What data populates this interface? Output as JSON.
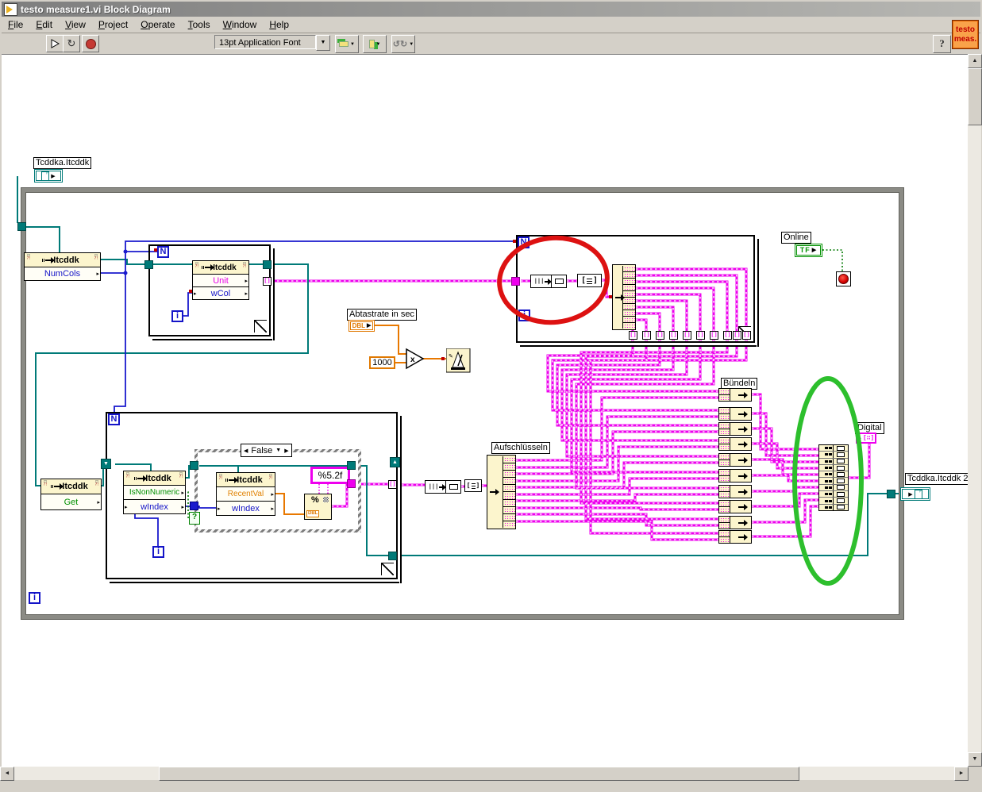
{
  "window": {
    "title": "testo measure1.vi Block Diagram",
    "close": "×"
  },
  "menu": {
    "items": [
      "File",
      "Edit",
      "View",
      "Project",
      "Operate",
      "Tools",
      "Window",
      "Help"
    ]
  },
  "toolbar": {
    "font": "13pt Application Font",
    "help": "?"
  },
  "vi_icon": {
    "line1": "testo",
    "line2": "meas."
  },
  "diagram": {
    "source_label": "Tcddka.Itcddk",
    "sink_label": "Tcddka.Itcddk 2",
    "loops": {
      "count": "N",
      "iter": "i"
    },
    "numcols": {
      "title": "Itcddk",
      "row0": "NumCols"
    },
    "unit": {
      "title": "Itcddk",
      "row0": "Unit",
      "row1": "wCol"
    },
    "get": {
      "title": "Itcddk",
      "row0": "Get"
    },
    "isnum": {
      "title": "Itcddk",
      "row0": "IsNonNumeric",
      "row1": "wIndex"
    },
    "recent": {
      "title": "Itcddk",
      "row0": "RecentVal",
      "row1": "wIndex"
    },
    "sample_rate_label": "Abtastrate in sec",
    "dbl": "DBL",
    "const_1000": "1000",
    "online_label": "Online",
    "tf": "TF",
    "bundle_label": "Bündeln",
    "digital_label": "Digital",
    "unbundle_label": "Aufschlüsseln",
    "format_string": "%5.2f",
    "case_value": "False",
    "selector": "?"
  },
  "scrollbars": {
    "up": "▲",
    "down": "▼",
    "left": "◄",
    "right": "►"
  },
  "icons": {
    "dropdown": "▼",
    "run_continuous": "↻"
  },
  "colors": {
    "wire_string": "#ee00ee",
    "wire_refnum": "#007a78",
    "wire_numeric": "#1a1acd",
    "wire_dbl": "#e87800",
    "wire_bool": "#007800",
    "annotation_red": "#dd1111",
    "annotation_green": "#2dbf2d"
  }
}
